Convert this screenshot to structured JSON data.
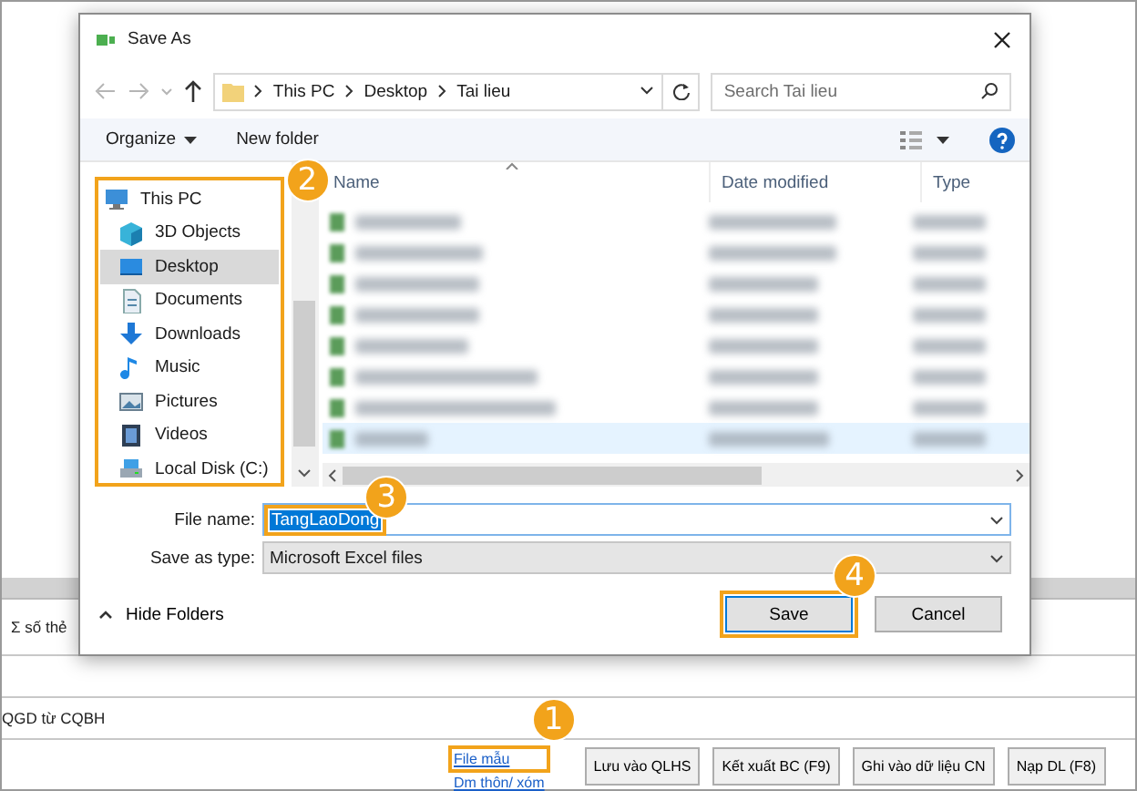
{
  "background_app": {
    "summary_label": "Σ số thẻ",
    "qgd_label": "QGD từ CQBH",
    "links": [
      {
        "label": "File mẫu"
      },
      {
        "label": "Dm thôn/ xóm"
      }
    ],
    "buttons": [
      {
        "label": "Lưu vào QLHS"
      },
      {
        "label": "Kết xuất BC (F9)"
      },
      {
        "label": "Ghi vào dữ liệu CN"
      },
      {
        "label": "Nạp DL (F8)"
      }
    ]
  },
  "dialog": {
    "title": "Save As",
    "address": {
      "crumbs": [
        "This PC",
        "Desktop",
        "Tai lieu"
      ]
    },
    "search": {
      "placeholder": "Search Tai lieu"
    },
    "toolbar": {
      "organize": "Organize",
      "new_folder": "New folder"
    },
    "nav_items": [
      {
        "label": "This PC",
        "kind": "pc",
        "selected": false
      },
      {
        "label": "3D Objects",
        "kind": "objects",
        "selected": false
      },
      {
        "label": "Desktop",
        "kind": "desktop",
        "selected": true
      },
      {
        "label": "Documents",
        "kind": "documents",
        "selected": false
      },
      {
        "label": "Downloads",
        "kind": "downloads",
        "selected": false
      },
      {
        "label": "Music",
        "kind": "music",
        "selected": false
      },
      {
        "label": "Pictures",
        "kind": "pictures",
        "selected": false
      },
      {
        "label": "Videos",
        "kind": "videos",
        "selected": false
      },
      {
        "label": "Local Disk (C:)",
        "kind": "disk",
        "selected": false
      }
    ],
    "columns": [
      "Name",
      "Date modified",
      "Type"
    ],
    "file_rows": [
      {
        "selected": false
      },
      {
        "selected": false
      },
      {
        "selected": false
      },
      {
        "selected": false
      },
      {
        "selected": false
      },
      {
        "selected": false
      },
      {
        "selected": false
      },
      {
        "selected": true
      }
    ],
    "file_name": {
      "label": "File name:",
      "value": "TangLaoDong"
    },
    "save_type": {
      "label": "Save as type:",
      "value": "Microsoft Excel files"
    },
    "hide_folders": "Hide Folders",
    "buttons": [
      {
        "label": "Save",
        "kind": "primary"
      },
      {
        "label": "Cancel",
        "kind": "normal"
      }
    ]
  },
  "callouts": [
    {
      "number": "1"
    },
    {
      "number": "2"
    },
    {
      "number": "3"
    },
    {
      "number": "4"
    }
  ]
}
